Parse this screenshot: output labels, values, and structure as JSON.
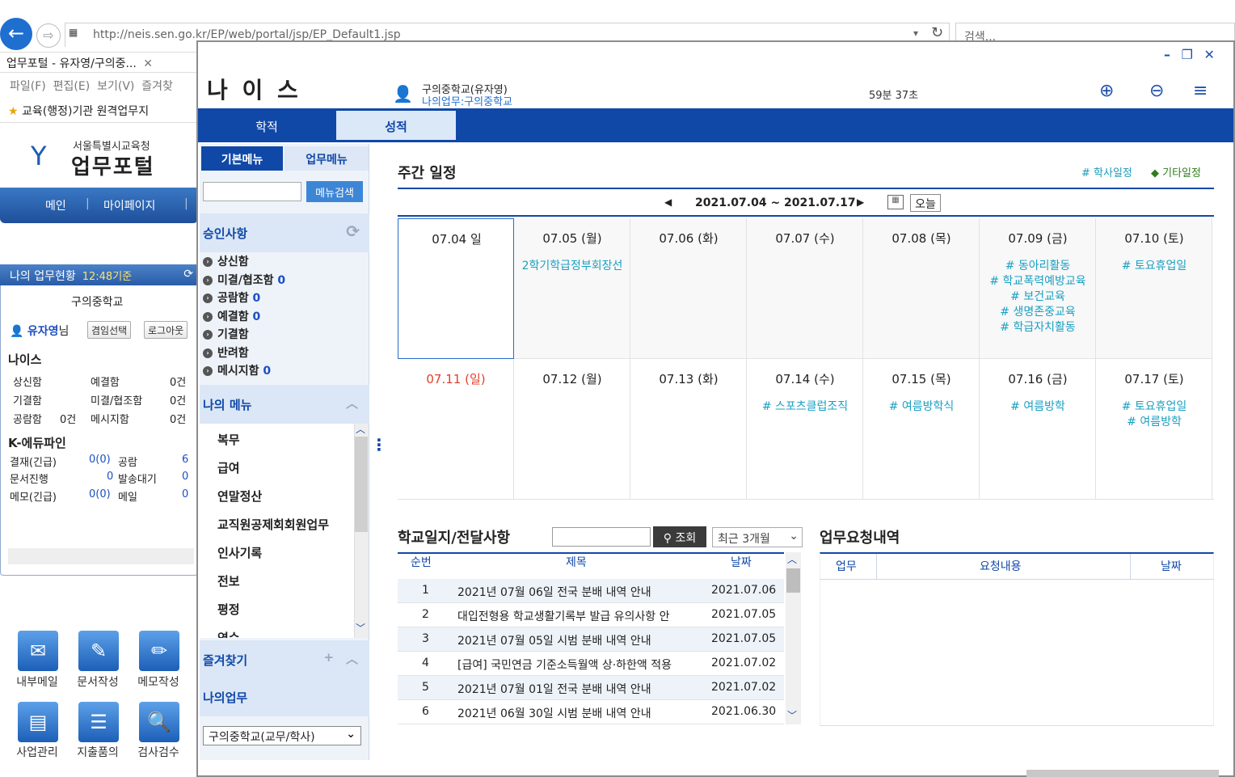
{
  "browser": {
    "url": "http://neis.sen.go.kr/EP/web/portal/jsp/EP_Default1.jsp",
    "search_placeholder": "검색...",
    "tab_title": "업무포털 - 유자영/구의중...",
    "menu_items": [
      "파일(F)",
      "편집(E)",
      "보기(V)",
      "즐겨찾"
    ],
    "favorite": "교육(행정)기관 원격업무지"
  },
  "portal": {
    "org_small": "서울특별시교육청",
    "org_big": "업무포털",
    "nav": [
      "메인",
      "마이페이지"
    ],
    "status_title": "나의 업무현황",
    "status_time": "12:48기준",
    "school": "구의중학교",
    "user": "유자영",
    "user_suffix": "님",
    "btn_role": "겸임선택",
    "btn_logout": "로그아웃",
    "neis_label": "나이스",
    "neis_rows": [
      {
        "a": "상신함",
        "b": "예결함",
        "c": "0건"
      },
      {
        "a": "기결함",
        "b": "미결/협조함",
        "c": "0건"
      },
      {
        "a": "공람함",
        "a2": "0건",
        "b": "메시지함",
        "c": "0건"
      }
    ],
    "k_label": "K-에듀파인",
    "k_rows": [
      {
        "a": "결재(긴급)",
        "v": "0(0)",
        "b": "공람",
        "c": "6"
      },
      {
        "a": "문서진행",
        "v": "0",
        "b": "발송대기",
        "c": "0"
      },
      {
        "a": "메모(긴급)",
        "v": "0(0)",
        "b": "메일",
        "c": "0"
      }
    ],
    "apps": [
      "내부메일",
      "문서작성",
      "메모작성",
      "사업관리",
      "지출품의",
      "검사검수"
    ]
  },
  "neis": {
    "title": "나 이 스",
    "user_line1": "구의중학교(유자영)",
    "user_line2": "나의업무:구의중학교",
    "timer": "59분 37초",
    "win_controls": "– ❐ ✕",
    "tabs": [
      "학적",
      "성적"
    ],
    "side_tabs": [
      "기본메뉴",
      "업무메뉴"
    ],
    "menu_search_btn": "메뉴검색",
    "approval_title": "승인사항",
    "approvals": [
      {
        "label": "상신함",
        "count": ""
      },
      {
        "label": "미결/협조함",
        "count": "0"
      },
      {
        "label": "공람함",
        "count": "0"
      },
      {
        "label": "예결함",
        "count": "0"
      },
      {
        "label": "기결함",
        "count": ""
      },
      {
        "label": "반려함",
        "count": ""
      },
      {
        "label": "메시지함",
        "count": "0"
      }
    ],
    "my_menu_title": "나의 메뉴",
    "my_menu": [
      "복무",
      "급여",
      "연말정산",
      "교직원공제회회원업무",
      "인사기록",
      "전보",
      "평정",
      "연수"
    ],
    "bookmarks_title": "즐겨찾기",
    "my_work_title": "나의업무",
    "school_select": "구의중학교(교무/학사)",
    "weekly_title": "주간 일정",
    "legend_school": "# 학사일정",
    "legend_other": "◆ 기타일정",
    "week_range": "2021.07.04 ~ 2021.07.17",
    "today_btn": "오늘",
    "week1": [
      {
        "day": "07.04 일",
        "events": []
      },
      {
        "day": "07.05 (월)",
        "events": [
          "2학기학급정부회장선"
        ]
      },
      {
        "day": "07.06 (화)",
        "events": []
      },
      {
        "day": "07.07 (수)",
        "events": []
      },
      {
        "day": "07.08 (목)",
        "events": []
      },
      {
        "day": "07.09 (금)",
        "events": [
          "# 동아리활동",
          "# 학교폭력예방교육",
          "# 보건교육",
          "# 생명존중교육",
          "# 학급자치활동"
        ]
      },
      {
        "day": "07.10 (토)",
        "events": [
          "# 토요휴업일"
        ]
      }
    ],
    "week2": [
      {
        "day": "07.11 (일)",
        "events": []
      },
      {
        "day": "07.12 (월)",
        "events": []
      },
      {
        "day": "07.13 (화)",
        "events": []
      },
      {
        "day": "07.14 (수)",
        "events": [
          "# 스포츠클럽조직"
        ]
      },
      {
        "day": "07.15 (목)",
        "events": [
          "# 여름방학식"
        ]
      },
      {
        "day": "07.16 (금)",
        "events": [
          "# 여름방학"
        ]
      },
      {
        "day": "07.17 (토)",
        "events": [
          "# 토요휴업일",
          "# 여름방학"
        ]
      }
    ],
    "diary_title": "학교일지/전달사항",
    "diary_btn": "조회",
    "diary_period": "최근 3개월",
    "diary_cols": [
      "순번",
      "제목",
      "날짜"
    ],
    "diary_rows": [
      {
        "n": "1",
        "title": "2021년 07월 06일 전국 분배 내역 안내",
        "date": "2021.07.06"
      },
      {
        "n": "2",
        "title": "대입전형용 학교생활기록부 발급 유의사항 안",
        "date": "2021.07.05"
      },
      {
        "n": "3",
        "title": "2021년 07월 05일 시범 분배 내역 안내",
        "date": "2021.07.05"
      },
      {
        "n": "4",
        "title": "[급여] 국민연금 기준소득월액 상·하한액 적용",
        "date": "2021.07.02"
      },
      {
        "n": "5",
        "title": "2021년 07월 01일 전국 분배 내역 안내",
        "date": "2021.07.02"
      },
      {
        "n": "6",
        "title": "2021년 06월 30일 시범 분배 내역 안내",
        "date": "2021.06.30"
      }
    ],
    "req_title": "업무요청내역",
    "req_cols": [
      "업무",
      "요청내용",
      "날짜"
    ]
  }
}
